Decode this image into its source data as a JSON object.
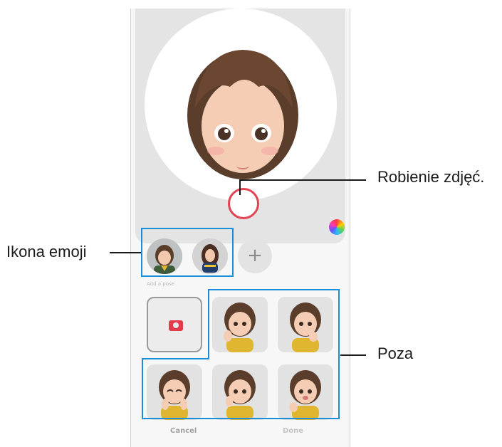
{
  "callouts": {
    "capture": "Robienie zdjęć.",
    "emoji_icon": "Ikona emoji",
    "pose": "Poza"
  },
  "screen": {
    "add_emoji_label": "+",
    "pose_section_label": "Add a pose",
    "cancel_label": "Cancel",
    "done_label": "Done"
  },
  "icons": [
    "camera-icon",
    "color-palette-icon",
    "plus-icon"
  ],
  "colors": {
    "highlight": "#1a8fd9",
    "capture_ring": "#e24452",
    "camera_icon": "#e33b4a"
  }
}
